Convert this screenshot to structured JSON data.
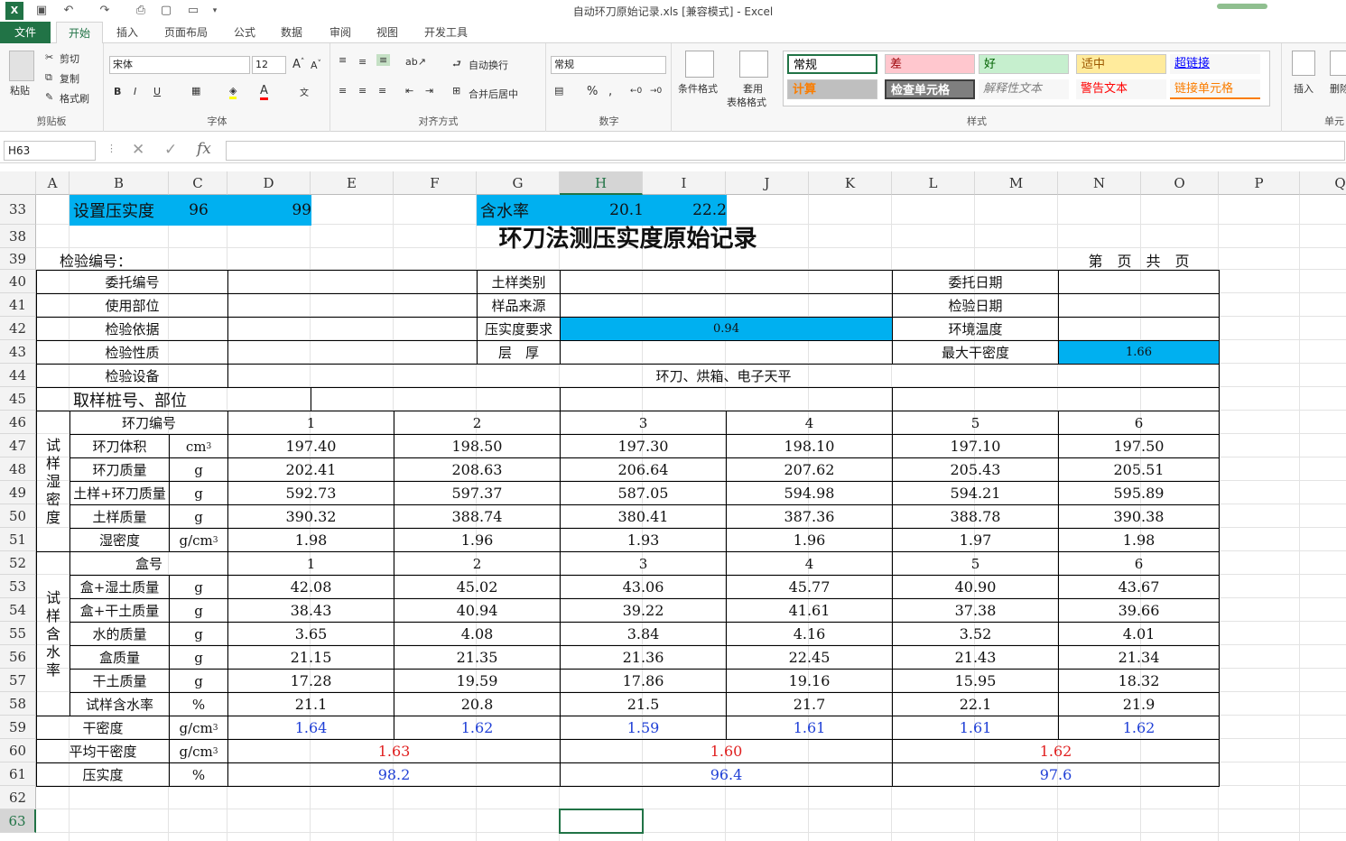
{
  "window": {
    "title": "自动环刀原始记录.xls  [兼容模式] - Excel"
  },
  "tabs": [
    "文件",
    "开始",
    "插入",
    "页面布局",
    "公式",
    "数据",
    "审阅",
    "视图",
    "开发工具"
  ],
  "ribbon": {
    "clipboard": {
      "paste": "粘贴",
      "cut": "剪切",
      "copy": "复制",
      "format_painter": "格式刷",
      "label": "剪贴板"
    },
    "font": {
      "name": "宋体",
      "size": "12",
      "label": "字体",
      "bold": "B",
      "italic": "I",
      "underline": "U"
    },
    "align": {
      "wrap": "自动换行",
      "merge": "合并后居中",
      "label": "对齐方式"
    },
    "number": {
      "format": "常规",
      "label": "数字",
      "percent": "%",
      "comma": ","
    },
    "styles": {
      "cond_format": "条件格式",
      "table_format_1": "套用",
      "table_format_2": "表格格式",
      "items": [
        {
          "label": "常规",
          "bg": "#ffffff",
          "color": "#000000"
        },
        {
          "label": "差",
          "bg": "#ffc7ce",
          "color": "#9c0006"
        },
        {
          "label": "好",
          "bg": "#c6efce",
          "color": "#006100"
        },
        {
          "label": "适中",
          "bg": "#ffeb9c",
          "color": "#9c5700"
        },
        {
          "label": "超链接",
          "bg": "#f7f7f7",
          "color": "#0000ff"
        },
        {
          "label": "计算",
          "bg": "#bfbfbf",
          "color": "#fa7d00"
        },
        {
          "label": "检查单元格",
          "bg": "#7f7f7f",
          "color": "#ffffff"
        },
        {
          "label": "解释性文本",
          "bg": "#f7f7f7",
          "color": "#7f7f7f"
        },
        {
          "label": "警告文本",
          "bg": "#f7f7f7",
          "color": "#ff0000"
        },
        {
          "label": "链接单元格",
          "bg": "#f7f7f7",
          "color": "#fa7d00"
        }
      ],
      "label": "样式"
    },
    "cells": {
      "insert": "插入",
      "delete": "删除",
      "label": "单元"
    }
  },
  "formula_bar": {
    "name_box": "H63",
    "fx": "fx",
    "content": ""
  },
  "columns": [
    "A",
    "B",
    "C",
    "D",
    "E",
    "F",
    "G",
    "H",
    "I",
    "J",
    "K",
    "L",
    "M",
    "N",
    "O",
    "P",
    "Q"
  ],
  "rows": [
    "33",
    "38",
    "39",
    "40",
    "41",
    "42",
    "43",
    "44",
    "45",
    "46",
    "47",
    "48",
    "49",
    "50",
    "51",
    "52",
    "53",
    "54",
    "55",
    "56",
    "57",
    "58",
    "59",
    "60",
    "61",
    "62",
    "63"
  ],
  "row33": {
    "set_label": "设置压实度",
    "set_a": "96",
    "set_b": "99",
    "wc_label": "含水率",
    "wc_a": "20.1",
    "wc_b": "22.2"
  },
  "title": "环刀法测压实度原始记录",
  "header": {
    "test_no": "检验编号：",
    "page": "第　页　共　页"
  },
  "info": {
    "r40": [
      "委托编号",
      "土样类别",
      "委托日期"
    ],
    "r41": [
      "使用部位",
      "样品来源",
      "检验日期"
    ],
    "r42": [
      "检验依据",
      "压实度要求",
      "0.94",
      "环境温度"
    ],
    "r43": [
      "检验性质",
      "层　厚",
      "最大干密度",
      "1.66"
    ],
    "r44": [
      "检验设备",
      "环刀、烘箱、电子天平"
    ],
    "r45": "取样桩号、部位"
  },
  "density": {
    "side": "试样湿密度",
    "header": [
      "环刀编号",
      "1",
      "2",
      "3",
      "4",
      "5",
      "6"
    ],
    "rows": [
      [
        "环刀体积",
        "cm",
        "3",
        "197.40",
        "198.50",
        "197.30",
        "198.10",
        "197.10",
        "197.50"
      ],
      [
        "环刀质量",
        "g",
        "",
        "202.41",
        "208.63",
        "206.64",
        "207.62",
        "205.43",
        "205.51"
      ],
      [
        "土样+环刀质量",
        "g",
        "",
        "592.73",
        "597.37",
        "587.05",
        "594.98",
        "594.21",
        "595.89"
      ],
      [
        "土样质量",
        "g",
        "",
        "390.32",
        "388.74",
        "380.41",
        "387.36",
        "388.78",
        "390.38"
      ],
      [
        "湿密度",
        "g/cm",
        "3",
        "1.98",
        "1.96",
        "1.93",
        "1.96",
        "1.97",
        "1.98"
      ]
    ]
  },
  "moisture": {
    "side": "试样含水率",
    "header": [
      "盒号",
      "1",
      "2",
      "3",
      "4",
      "5",
      "6"
    ],
    "rows": [
      [
        "盒+湿土质量",
        "g",
        "",
        "42.08",
        "45.02",
        "43.06",
        "45.77",
        "40.90",
        "43.67"
      ],
      [
        "盒+干土质量",
        "g",
        "",
        "38.43",
        "40.94",
        "39.22",
        "41.61",
        "37.38",
        "39.66"
      ],
      [
        "水的质量",
        "g",
        "",
        "3.65",
        "4.08",
        "3.84",
        "4.16",
        "3.52",
        "4.01"
      ],
      [
        "盒质量",
        "g",
        "",
        "21.15",
        "21.35",
        "21.36",
        "22.45",
        "21.43",
        "21.34"
      ],
      [
        "干土质量",
        "g",
        "",
        "17.28",
        "19.59",
        "17.86",
        "19.16",
        "15.95",
        "18.32"
      ],
      [
        "试样含水率",
        "%",
        "",
        "21.1",
        "20.8",
        "21.5",
        "21.7",
        "22.1",
        "21.9"
      ]
    ]
  },
  "dry": [
    "干密度",
    "g/cm",
    "3",
    "1.64",
    "1.62",
    "1.59",
    "1.61",
    "1.61",
    "1.62"
  ],
  "avg": [
    "平均干密度",
    "g/cm",
    "3",
    "1.63",
    "1.60",
    "1.62"
  ],
  "comp": [
    "压实度",
    "%",
    "98.2",
    "96.4",
    "97.6"
  ]
}
